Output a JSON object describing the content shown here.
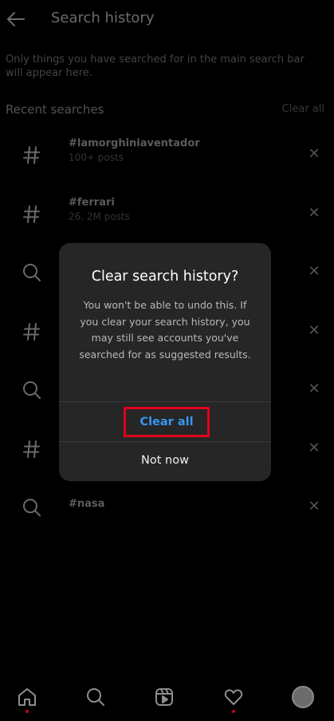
{
  "header": {
    "title": "Search history"
  },
  "description": "Only things you have searched for in the main search bar will appear here.",
  "recent": {
    "title": "Recent searches",
    "clear_all": "Clear all"
  },
  "rows": [
    {
      "icon": "hashtag-icon",
      "name": "#lamorghiniaventador",
      "sub": "100+ posts"
    },
    {
      "icon": "hashtag-icon",
      "name": "#ferrari",
      "sub": "26. 2M posts"
    },
    {
      "icon": "search-icon",
      "name": "",
      "sub": ""
    },
    {
      "icon": "hashtag-icon",
      "name": "",
      "sub": ""
    },
    {
      "icon": "search-icon",
      "name": "",
      "sub": ""
    },
    {
      "icon": "hashtag-icon",
      "name": "",
      "sub": ""
    },
    {
      "icon": "search-icon",
      "name": "#nasa",
      "sub": ""
    }
  ],
  "dialog": {
    "title": "Clear search history?",
    "body": "You won't be able to undo this. If you clear your search history, you may still see accounts you've searched for as suggested results.",
    "clear_button": "Clear all",
    "not_now_button": "Not now"
  },
  "colors": {
    "accent": "#3897f0",
    "highlight": "#e0001c",
    "dialog_bg": "#262626"
  },
  "bottom_nav": [
    "home-icon",
    "search-icon",
    "reels-icon",
    "heart-icon",
    "profile-avatar"
  ]
}
